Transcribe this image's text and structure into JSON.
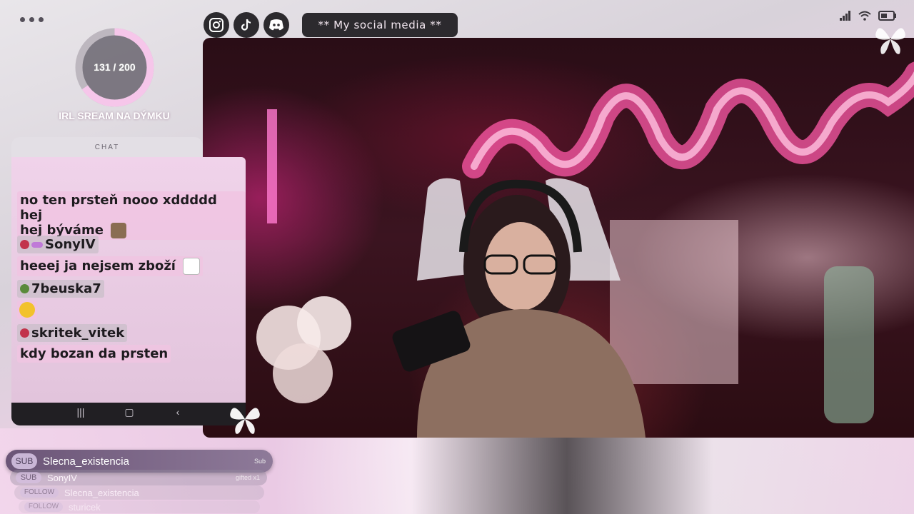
{
  "goal": {
    "progress_text": "131 / 200",
    "current": 131,
    "target": 200,
    "label": "IRL SREAM NA DÝMKU"
  },
  "social": {
    "pill_text": "** My social media **",
    "icons": [
      "instagram-icon",
      "tiktok-icon",
      "discord-icon"
    ]
  },
  "chat": {
    "header": "CHAT",
    "messages": [
      {
        "type": "text",
        "text": "no ten prsteň nooo xddddd hej",
        "cont": "hej býváme"
      },
      {
        "type": "user",
        "name": "SonyIV"
      },
      {
        "type": "text",
        "text": "heeej ja nejsem zboží"
      },
      {
        "type": "user",
        "name": "7beuska7"
      },
      {
        "type": "user",
        "name": "skritek_vitek"
      },
      {
        "type": "text",
        "text": "kdy bozan da prsten"
      }
    ]
  },
  "alerts": [
    {
      "tag": "SUB",
      "name": "Slecna_existencia",
      "extra": "Sub"
    },
    {
      "tag": "SUB",
      "name": "SonyIV",
      "extra": "gifted x1"
    },
    {
      "tag": "FOLLOW",
      "name": "Slecna_existencia",
      "extra": ""
    },
    {
      "tag": "FOLLOW",
      "name": "sturicek",
      "extra": ""
    }
  ],
  "colors": {
    "accent_pink": "#f4c1e4",
    "dark": "#2c2a2e"
  }
}
